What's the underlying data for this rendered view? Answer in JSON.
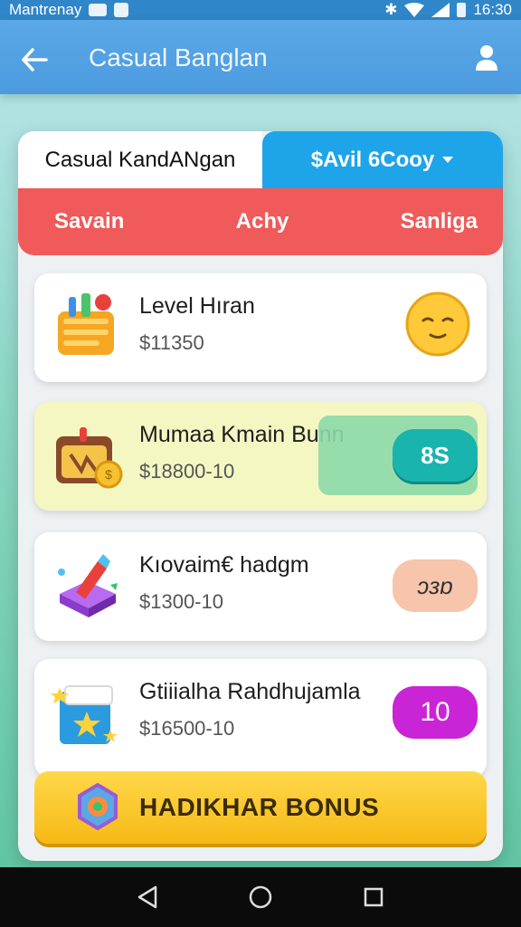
{
  "status_bar": {
    "carrier": "Mantrenay",
    "time": "16:30"
  },
  "app_bar": {
    "title": "Casual Banglan"
  },
  "tabs": {
    "left_label": "Casual KandANgan",
    "right_label": "$Avil 6Cooy"
  },
  "filter_bar": {
    "items": [
      "Savain",
      "Achy",
      "Sanliga"
    ]
  },
  "cards": [
    {
      "title": "Level Hıran",
      "subtitle": "$11350",
      "icon": "folder-gift-icon",
      "badge": "",
      "badge_icon": "smiley-face-icon"
    },
    {
      "title": "Mumaa Kmain Bunn",
      "subtitle": "$18800-10",
      "icon": "treasure-chest-icon",
      "badge": "8S"
    },
    {
      "title": "Kıovaim€ hadgm",
      "subtitle": "$1300-10",
      "icon": "magic-box-icon",
      "badge": "ɔɜɒ"
    },
    {
      "title": "Gtiiialha Rahdhujamla",
      "subtitle": "$16500-10",
      "icon": "star-book-icon",
      "badge": "10"
    }
  ],
  "bonus_button": {
    "label": "HADIKHAR BONUS",
    "icon": "gem-icon"
  },
  "colors": {
    "app_bar": "#4c9be0",
    "tab_active": "#1ea4e9",
    "filter_bar": "#f05a5a",
    "bonus": "#f6b916"
  }
}
